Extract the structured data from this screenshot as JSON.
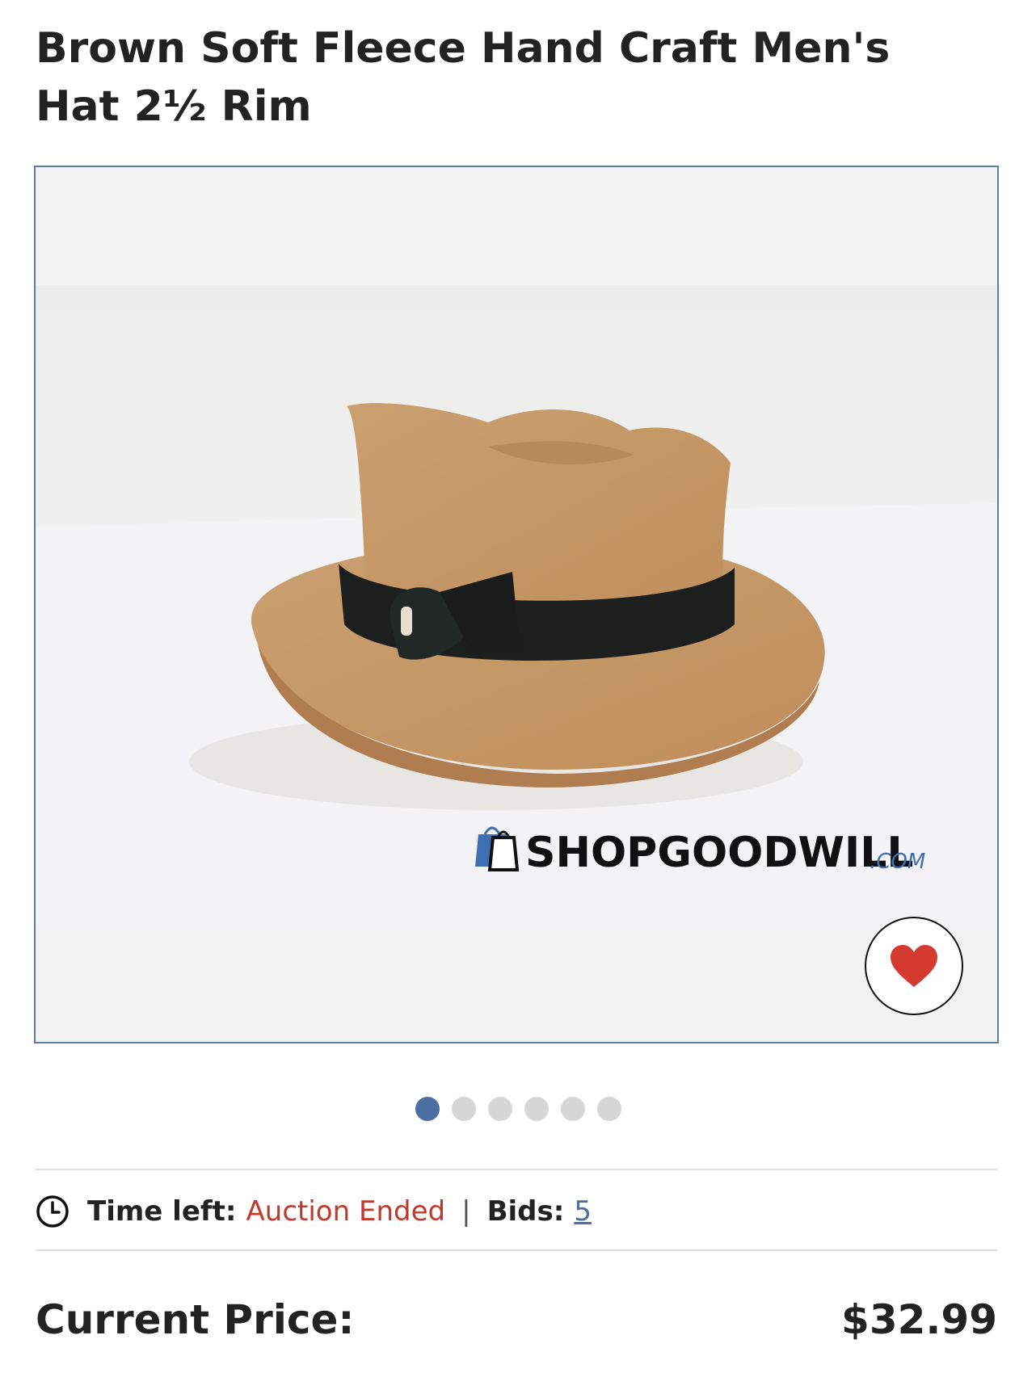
{
  "product": {
    "title": "Brown Soft Fleece Hand Craft Men's Hat 2½ Rim"
  },
  "gallery": {
    "watermark_main": "SHOPGOODWILL",
    "watermark_suffix": ".COM",
    "favorite_icon": "heart-icon",
    "heart_color": "#d43a2f",
    "slide_count": 6,
    "active_slide": 1
  },
  "auction": {
    "time_left_label": "Time left:",
    "time_left_value": "Auction Ended",
    "separator": "|",
    "bids_label": "Bids:",
    "bids_value": "5",
    "clock_icon": "clock-icon"
  },
  "price": {
    "label": "Current Price:",
    "value": "$32.99"
  },
  "colors": {
    "accent": "#4a6fa0",
    "ended": "#c0392b"
  }
}
